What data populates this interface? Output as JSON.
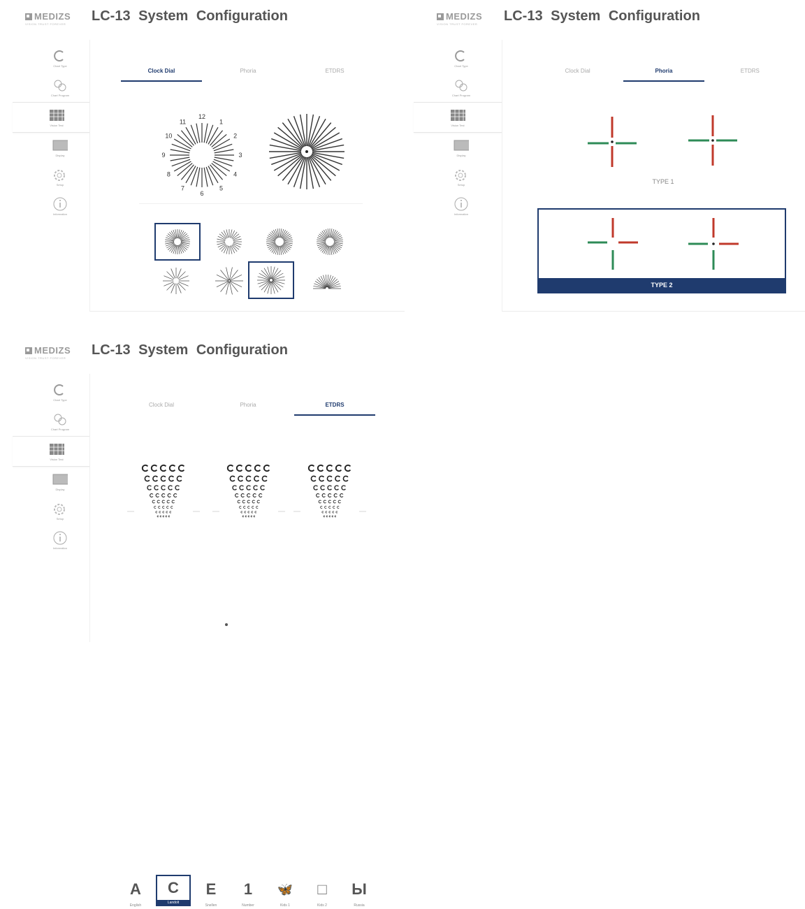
{
  "brand": {
    "name": "MEDIZS",
    "tagline": "VISION TRUST FOREVER"
  },
  "title": "LC-13  System  Configuration",
  "sidebar": [
    {
      "label": "Chart Type",
      "icon": "c-letter-icon"
    },
    {
      "label": "Chart Program",
      "icon": "gear-circles-icon"
    },
    {
      "label": "Vision Test",
      "icon": "grid-chart-icon"
    },
    {
      "label": "Display",
      "icon": "display-icon"
    },
    {
      "label": "Setup",
      "icon": "setup-gear-icon"
    },
    {
      "label": "Information",
      "icon": "info-icon"
    }
  ],
  "tabs": [
    "Clock Dial",
    "Phoria",
    "ETDRS"
  ],
  "clock_numbers": [
    "12",
    "1",
    "2",
    "3",
    "4",
    "5",
    "6",
    "7",
    "8",
    "9",
    "10",
    "11"
  ],
  "phoria": {
    "type1": "TYPE 1",
    "type2": "TYPE 2"
  },
  "etdrs_options": [
    {
      "glyph": "A",
      "label": "English"
    },
    {
      "glyph": "C",
      "label": "Landolt"
    },
    {
      "glyph": "E",
      "label": "Snellen"
    },
    {
      "glyph": "1",
      "label": "Number"
    },
    {
      "glyph": "🦋",
      "label": "Kids 1"
    },
    {
      "glyph": "□",
      "label": "Kids 2"
    },
    {
      "glyph": "Ы",
      "label": "Russia"
    }
  ],
  "colors": {
    "accent": "#1f3b6e",
    "phoria_red": "#c0392b",
    "phoria_green": "#2e8b57"
  }
}
